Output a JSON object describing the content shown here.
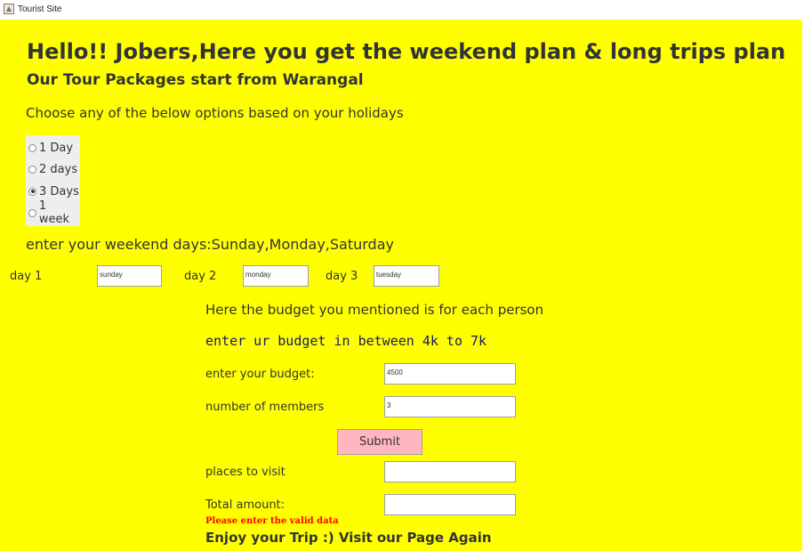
{
  "window": {
    "title": "Tourist Site"
  },
  "header": {
    "title": "Hello!! Jobers,Here you get the weekend plan & long trips plan",
    "subtitle": "Our Tour Packages start from  Warangal"
  },
  "options": {
    "prompt": "Choose any of the below options based on your holidays",
    "items": [
      {
        "label": "1 Day",
        "checked": false
      },
      {
        "label": "2 days",
        "checked": false
      },
      {
        "label": "3 Days",
        "checked": true
      },
      {
        "label": "1 week",
        "checked": false
      }
    ]
  },
  "weekend": {
    "prompt": "enter your weekend days:Sunday,Monday,Saturday",
    "day1_label": "day 1",
    "day1_value": "sunday",
    "day2_label": "day 2",
    "day2_value": "monday",
    "day3_label": "day 3",
    "day3_value": "tuesday"
  },
  "budget": {
    "note": "Here the budget you mentioned is for each person",
    "range": "enter ur budget in between 4k to 7k",
    "budget_label": "enter your budget:",
    "budget_value": "4500",
    "members_label": "number of members",
    "members_value": "3"
  },
  "actions": {
    "submit_label": "Submit"
  },
  "results": {
    "places_label": "places to visit",
    "places_value": "",
    "total_label": "Total amount:",
    "total_value": "",
    "error_text": "Please enter the valid data",
    "footer_text": "Enjoy your Trip :) Visit our Page Again"
  },
  "colors": {
    "background": "#ffff00",
    "text": "#333333",
    "submit_button": "#ffb6c1",
    "error": "#ff0000"
  }
}
